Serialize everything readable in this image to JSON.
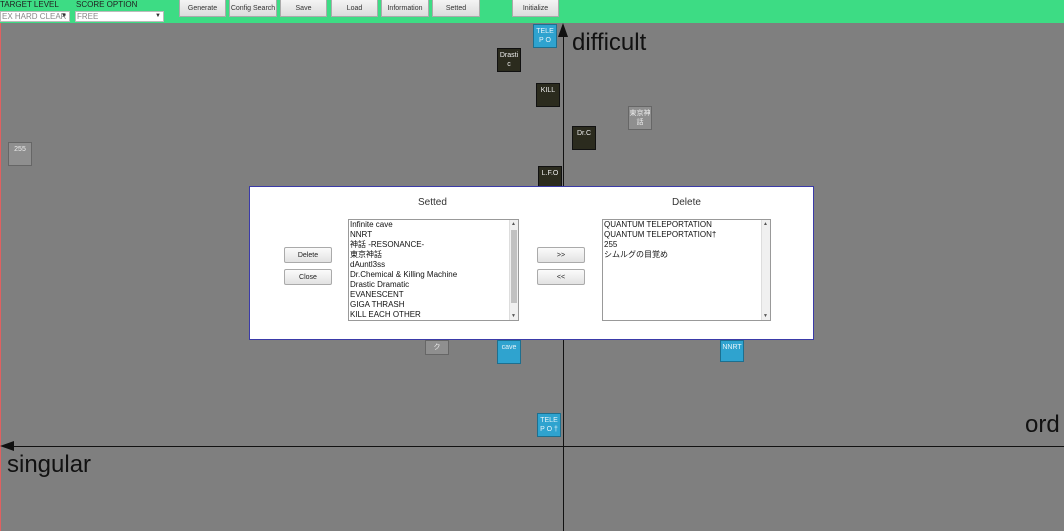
{
  "topbar": {
    "target_level_label": "TARGET LEVEL",
    "target_level_value": "EX HARD CLEAR",
    "score_option_label": "SCORE OPTION",
    "score_option_value": "FREE",
    "buttons": [
      "Generate",
      "Config Search",
      "Save",
      "Load",
      "Information",
      "Setted",
      "Initialize"
    ],
    "accent_color": "#3ddc84"
  },
  "axes": {
    "top": "difficult",
    "right": "ord",
    "left": "singular"
  },
  "tiles": [
    {
      "label": "TELEP O",
      "style": "blue"
    },
    {
      "label": "Drasti c",
      "style": "dark"
    },
    {
      "label": "KILL",
      "style": "dark"
    },
    {
      "label": "東京神 話",
      "style": "gray"
    },
    {
      "label": "Dr.C",
      "style": "dark"
    },
    {
      "label": "255",
      "style": "gray"
    },
    {
      "label": "L.F.O",
      "style": "dark"
    },
    {
      "label": "ク",
      "style": "gray"
    },
    {
      "label": "cave",
      "style": "blue"
    },
    {
      "label": "NNRT",
      "style": "blue"
    },
    {
      "label": "TELEP O †",
      "style": "blue"
    }
  ],
  "dialog": {
    "setted_title": "Setted",
    "delete_title": "Delete",
    "delete_button": "Delete",
    "close_button": "Close",
    "move_right_button": ">>",
    "move_left_button": "<<",
    "setted_items": [
      "Infinite cave",
      "NNRT",
      "神話 -RESONANCE-",
      "東京神話",
      "dAuntl3ss",
      "Dr.Chemical & Killing Machine",
      "Drastic Dramatic",
      "EVANESCENT",
      "GIGA THRASH",
      "KILL EACH OTHER"
    ],
    "delete_items": [
      "QUANTUM TELEPORTATION",
      "QUANTUM TELEPORTATION†",
      "255",
      "シムルグの目覚め"
    ]
  }
}
